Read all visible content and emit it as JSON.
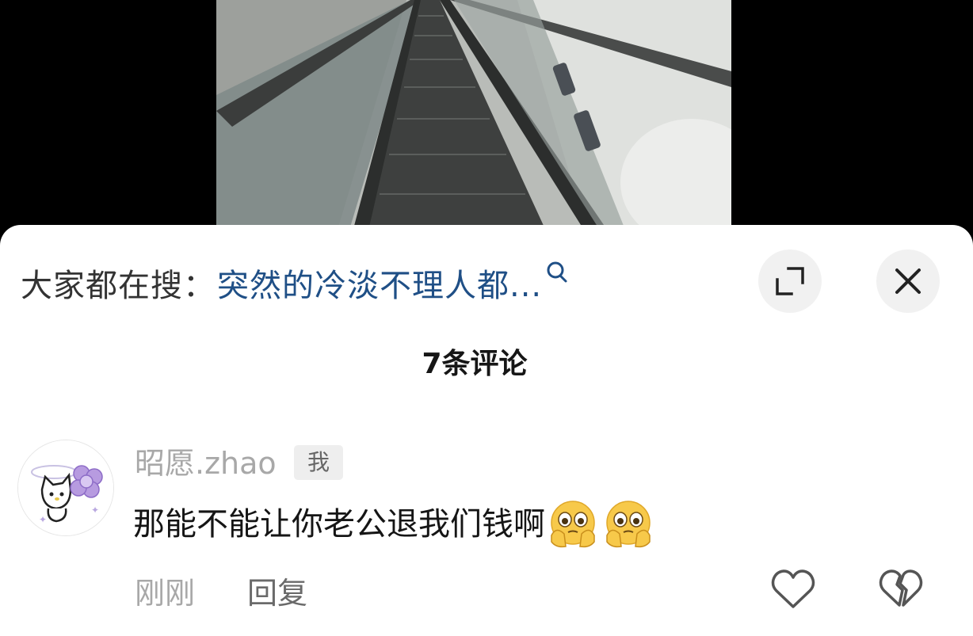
{
  "search": {
    "prefix": "大家都在搜：",
    "query": "突然的冷淡不理人都..."
  },
  "comments_header": {
    "title": "7条评论"
  },
  "comment": {
    "username": "昭愿.zhao",
    "badge": "我",
    "text": "那能不能让你老公退我们钱啊",
    "emoji_count": 2,
    "time": "刚刚",
    "reply_label": "回复"
  },
  "icons": {
    "search": "search-icon",
    "expand": "expand-icon",
    "close": "close-icon",
    "like": "heart-icon",
    "dislike": "broken-heart-icon",
    "emoji": "face-holding-back-tears-emoji"
  },
  "colors": {
    "link_blue": "#1f4f86",
    "muted_gray": "#a8a8a8",
    "button_bg": "#f1f1f1"
  }
}
